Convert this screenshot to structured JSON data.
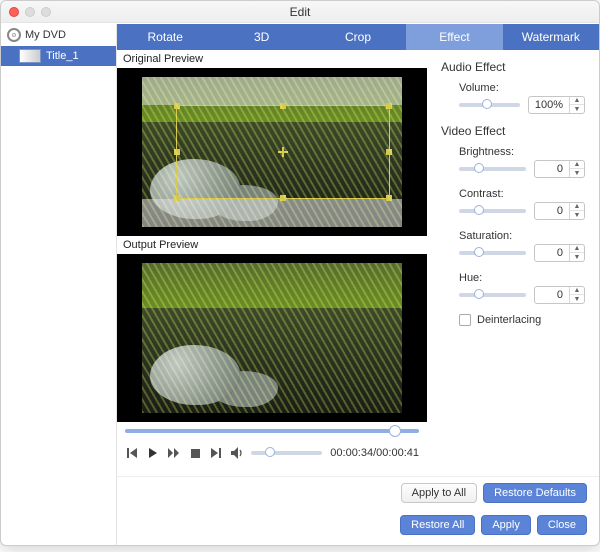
{
  "window": {
    "title": "Edit"
  },
  "sidebar": {
    "disc_label": "My DVD",
    "title_label": "Title_1"
  },
  "tabs": [
    {
      "label": "Rotate",
      "active": false
    },
    {
      "label": "3D",
      "active": false
    },
    {
      "label": "Crop",
      "active": false
    },
    {
      "label": "Effect",
      "active": true
    },
    {
      "label": "Watermark",
      "active": false
    }
  ],
  "preview": {
    "original_label": "Original Preview",
    "output_label": "Output Preview",
    "time_current": "00:00:34",
    "time_total": "00:00:41",
    "position_pct": 82,
    "volume_pct": 20
  },
  "effects": {
    "audio_heading": "Audio Effect",
    "video_heading": "Video Effect",
    "volume": {
      "label": "Volume:",
      "value": "100%",
      "slider_pct": 38
    },
    "brightness": {
      "label": "Brightness:",
      "value": "0",
      "slider_pct": 22
    },
    "contrast": {
      "label": "Contrast:",
      "value": "0",
      "slider_pct": 22
    },
    "saturation": {
      "label": "Saturation:",
      "value": "0",
      "slider_pct": 22
    },
    "hue": {
      "label": "Hue:",
      "value": "0",
      "slider_pct": 22
    },
    "deinterlace_label": "Deinterlacing",
    "deinterlace_checked": false
  },
  "buttons": {
    "apply_all": "Apply to All",
    "restore_defaults": "Restore Defaults",
    "restore_all": "Restore All",
    "apply": "Apply",
    "close": "Close"
  }
}
